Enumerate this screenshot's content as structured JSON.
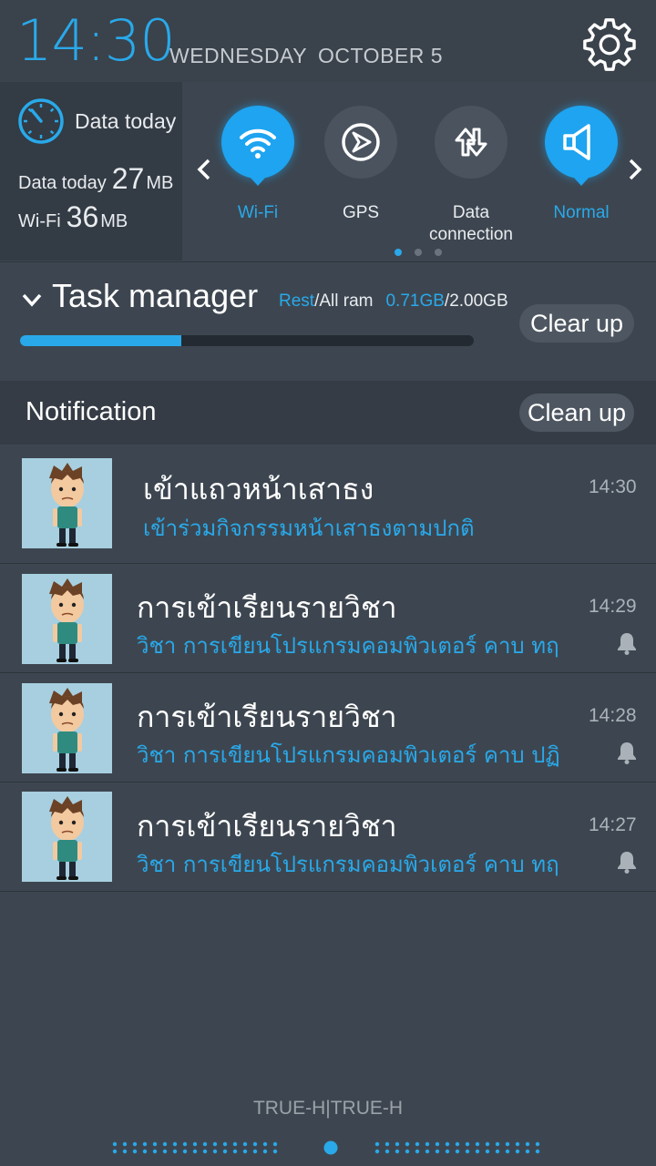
{
  "status": {
    "time": "14:30",
    "day": "WEDNESDAY",
    "date": "OCTOBER 5"
  },
  "data_usage": {
    "title": "Data today",
    "today_label": "Data today",
    "today_value": "27",
    "today_unit": "MB",
    "wifi_label": "Wi-Fi",
    "wifi_value": "36",
    "wifi_unit": "MB"
  },
  "quick_toggles": [
    {
      "label": "Wi-Fi",
      "icon": "wifi-icon",
      "active": true
    },
    {
      "label": "GPS",
      "icon": "gps-icon",
      "active": false
    },
    {
      "label": "Data connection",
      "icon": "data-connection-icon",
      "active": false
    },
    {
      "label": "Normal",
      "icon": "speaker-icon",
      "active": true
    }
  ],
  "quick_toggle_pages": {
    "count": 3,
    "current": 1
  },
  "task_manager": {
    "title": "Task manager",
    "rest_label": "Rest",
    "all_ram_label": "/All ram",
    "used": "0.71GB",
    "total": "/2.00GB",
    "progress_fraction": 0.355,
    "clear_button": "Clear up"
  },
  "notifications": {
    "header": "Notification",
    "clean_button": "Clean up",
    "items": [
      {
        "title": "เข้าแถวหน้าเสาธง",
        "subtitle": "เข้าร่วมกิจกรรมหน้าเสาธงตามปกติ",
        "time": "14:30",
        "bell": false
      },
      {
        "title": "การเข้าเรียนรายวิชา",
        "subtitle": "วิชา การเขียนโปรแกรมคอมพิวเตอร์ คาบ ทฤ",
        "time": "14:29",
        "bell": true
      },
      {
        "title": "การเข้าเรียนรายวิชา",
        "subtitle": "วิชา การเขียนโปรแกรมคอมพิวเตอร์ คาบ ปฏิ",
        "time": "14:28",
        "bell": true
      },
      {
        "title": "การเข้าเรียนรายวิชา",
        "subtitle": "วิชา การเขียนโปรแกรมคอมพิวเตอร์ คาบ ทฤ",
        "time": "14:27",
        "bell": true
      }
    ]
  },
  "carrier": "TRUE-H|TRUE-H",
  "colors": {
    "accent": "#29a9ea",
    "panel": "#3d4650",
    "thumb_bg": "#a7cfe0"
  }
}
